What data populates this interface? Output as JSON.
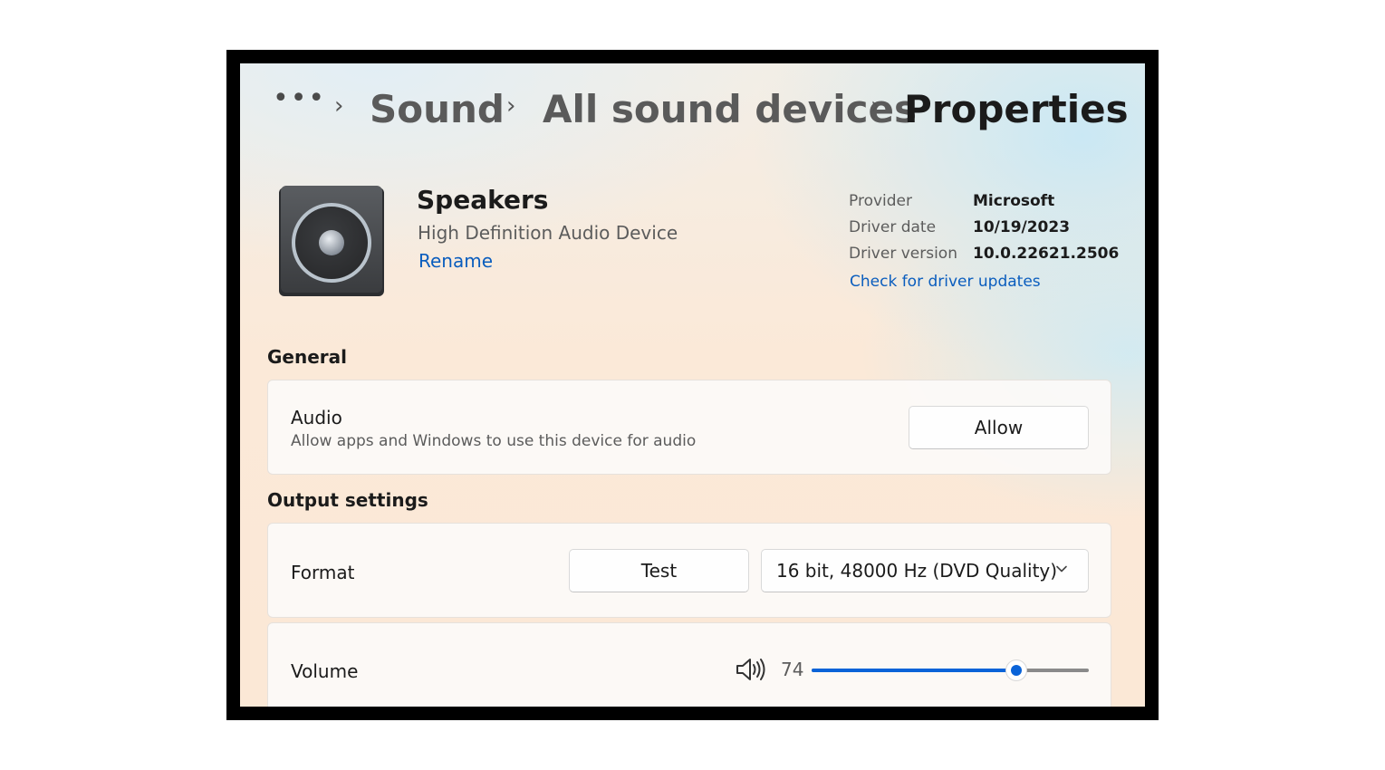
{
  "breadcrumb": {
    "more": "•••",
    "items": [
      "Sound",
      "All sound devices",
      "Properties"
    ]
  },
  "device": {
    "name": "Speakers",
    "subtitle": "High Definition Audio Device",
    "rename_label": "Rename",
    "icon": "speaker-icon"
  },
  "driver": {
    "rows": [
      {
        "label": "Provider",
        "value": "Microsoft"
      },
      {
        "label": "Driver date",
        "value": "10/19/2023"
      },
      {
        "label": "Driver version",
        "value": "10.0.22621.2506"
      }
    ],
    "update_link": "Check for driver updates"
  },
  "general": {
    "title": "General",
    "audio": {
      "title": "Audio",
      "description": "Allow apps and Windows to use this device for audio",
      "button": "Allow"
    }
  },
  "output": {
    "title": "Output settings",
    "format": {
      "title": "Format",
      "test_button": "Test",
      "selected": "16 bit, 48000 Hz (DVD Quality)"
    },
    "volume": {
      "title": "Volume",
      "value": "74",
      "percent": 74
    }
  },
  "colors": {
    "accent": "#0a63d8",
    "link": "#0a5dbe"
  }
}
